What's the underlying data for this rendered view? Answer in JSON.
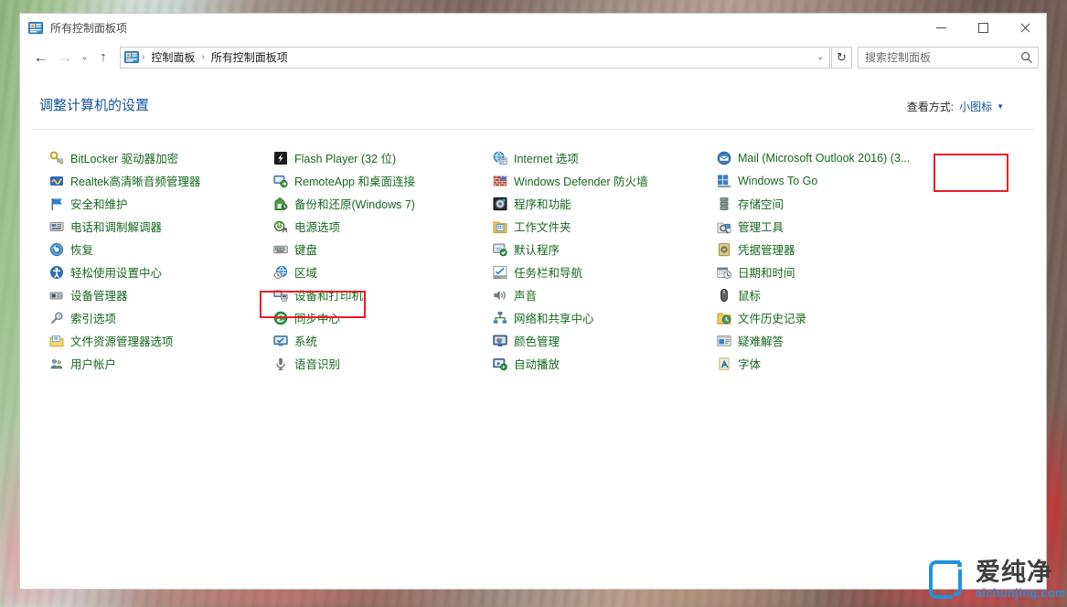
{
  "window": {
    "title": "所有控制面板项",
    "title_icon": "control-panel-icon",
    "controls": {
      "minimize": "最小化",
      "maximize": "最大化",
      "close": "关闭"
    }
  },
  "nav": {
    "back": "←",
    "forward": "→",
    "recent": "⌄",
    "up": "↑",
    "breadcrumb": {
      "icon": "control-panel-icon",
      "items": [
        "控制面板",
        "所有控制面板项"
      ],
      "separator": "›"
    },
    "dropdown_caret": "⌄",
    "refresh": "↻"
  },
  "search": {
    "placeholder": "搜索控制面板",
    "value": "",
    "icon": "search-icon"
  },
  "main": {
    "page_title": "调整计算机的设置",
    "view_by_label": "查看方式:",
    "view_by_value": "小图标",
    "view_by_caret": "▼"
  },
  "columns": [
    {
      "items": [
        {
          "label": "BitLocker 驱动器加密",
          "icon": "bitlocker-icon"
        },
        {
          "label": "Realtek高清晰音频管理器",
          "icon": "realtek-audio-icon"
        },
        {
          "label": "安全和维护",
          "icon": "security-flag-icon"
        },
        {
          "label": "电话和调制解调器",
          "icon": "phone-modem-icon"
        },
        {
          "label": "恢复",
          "icon": "recovery-icon"
        },
        {
          "label": "轻松使用设置中心",
          "icon": "ease-of-access-icon"
        },
        {
          "label": "设备管理器",
          "icon": "device-manager-icon"
        },
        {
          "label": "索引选项",
          "icon": "indexing-options-icon"
        },
        {
          "label": "文件资源管理器选项",
          "icon": "file-explorer-options-icon"
        },
        {
          "label": "用户帐户",
          "icon": "user-accounts-icon"
        }
      ]
    },
    {
      "items": [
        {
          "label": "Flash Player (32 位)",
          "icon": "flash-player-icon"
        },
        {
          "label": "RemoteApp 和桌面连接",
          "icon": "remoteapp-icon"
        },
        {
          "label": "备份和还原(Windows 7)",
          "icon": "backup-restore-icon"
        },
        {
          "label": "电源选项",
          "icon": "power-options-icon",
          "highlighted": true
        },
        {
          "label": "键盘",
          "icon": "keyboard-icon"
        },
        {
          "label": "区域",
          "icon": "region-icon"
        },
        {
          "label": "设备和打印机",
          "icon": "devices-printers-icon"
        },
        {
          "label": "同步中心",
          "icon": "sync-center-icon"
        },
        {
          "label": "系统",
          "icon": "system-icon"
        },
        {
          "label": "语音识别",
          "icon": "speech-recognition-icon"
        }
      ]
    },
    {
      "items": [
        {
          "label": "Internet 选项",
          "icon": "internet-options-icon"
        },
        {
          "label": "Windows Defender 防火墙",
          "icon": "windows-firewall-icon"
        },
        {
          "label": "程序和功能",
          "icon": "programs-features-icon"
        },
        {
          "label": "工作文件夹",
          "icon": "work-folders-icon"
        },
        {
          "label": "默认程序",
          "icon": "default-programs-icon"
        },
        {
          "label": "任务栏和导航",
          "icon": "taskbar-navigation-icon"
        },
        {
          "label": "声音",
          "icon": "sound-icon"
        },
        {
          "label": "网络和共享中心",
          "icon": "network-sharing-icon"
        },
        {
          "label": "颜色管理",
          "icon": "color-management-icon"
        },
        {
          "label": "自动播放",
          "icon": "autoplay-icon"
        }
      ]
    },
    {
      "items": [
        {
          "label": "Mail (Microsoft Outlook 2016) (3...",
          "icon": "mail-icon"
        },
        {
          "label": "Windows To Go",
          "icon": "windows-to-go-icon"
        },
        {
          "label": "存储空间",
          "icon": "storage-spaces-icon"
        },
        {
          "label": "管理工具",
          "icon": "administrative-tools-icon"
        },
        {
          "label": "凭据管理器",
          "icon": "credential-manager-icon"
        },
        {
          "label": "日期和时间",
          "icon": "date-time-icon"
        },
        {
          "label": "鼠标",
          "icon": "mouse-icon"
        },
        {
          "label": "文件历史记录",
          "icon": "file-history-icon"
        },
        {
          "label": "疑难解答",
          "icon": "troubleshooting-icon"
        },
        {
          "label": "字体",
          "icon": "fonts-icon"
        }
      ]
    }
  ],
  "annotations": [
    {
      "name": "power-options-highlight",
      "color": "#ee1c25"
    },
    {
      "name": "view-by-highlight",
      "color": "#ee1c25"
    }
  ],
  "watermark": {
    "cn": "爱纯净",
    "en": "aichunjing.com",
    "color": "#1f93dd"
  }
}
